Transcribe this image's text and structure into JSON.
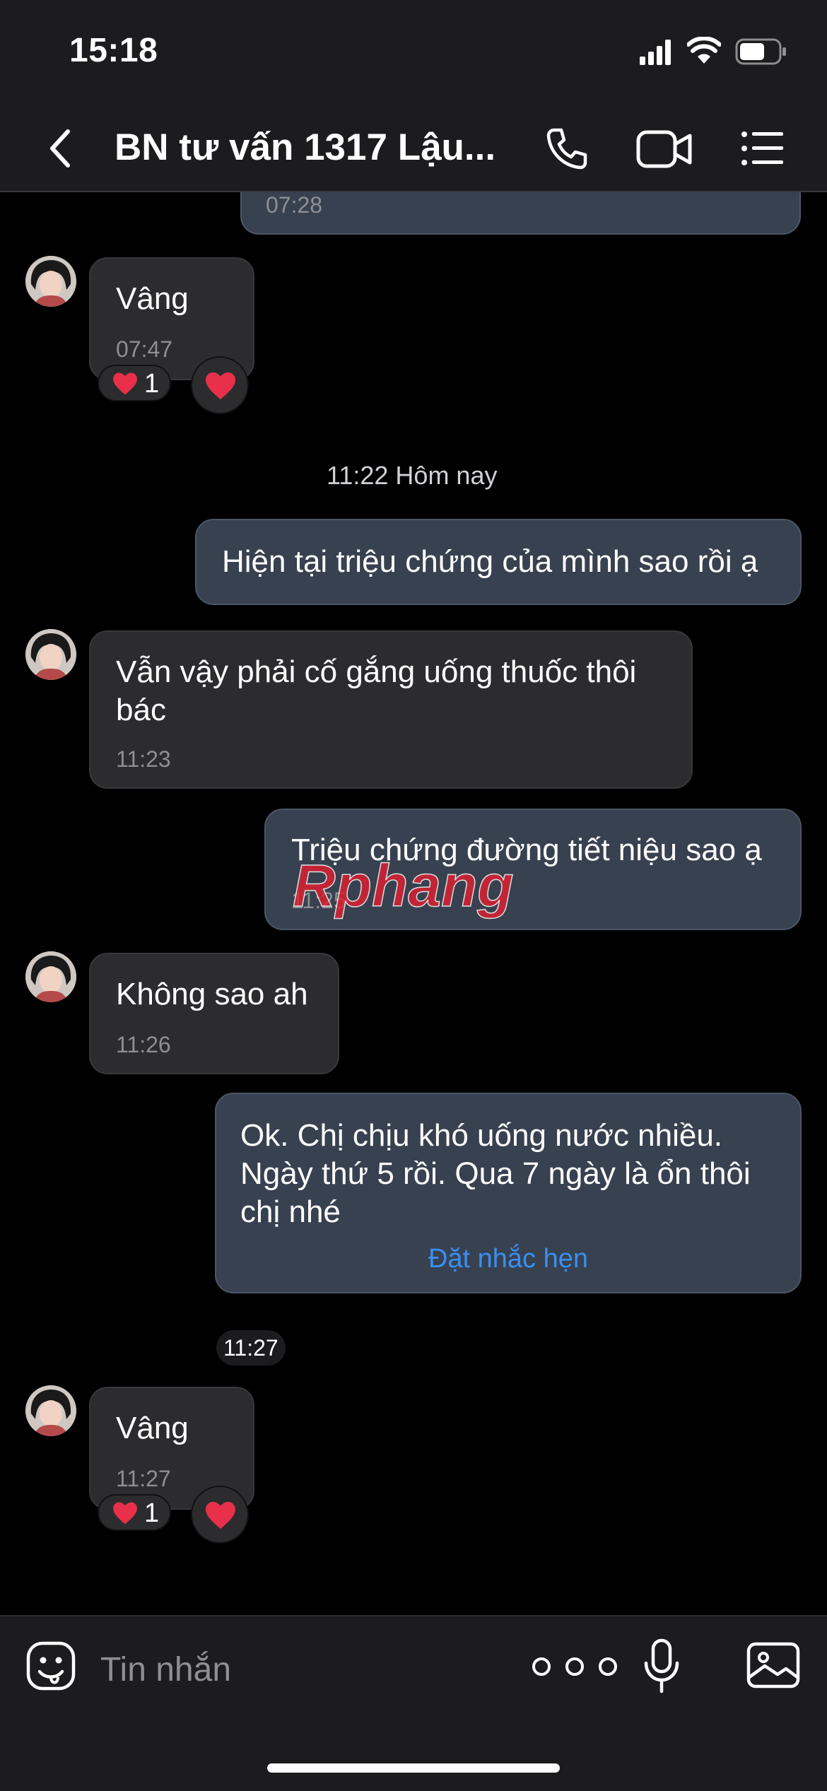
{
  "status_bar": {
    "time": "15:18"
  },
  "header": {
    "title": "BN tư vấn 1317 Lậu..."
  },
  "messages": {
    "prev_out_time": "07:28",
    "m1": {
      "text": "Vâng",
      "time": "07:47",
      "reaction_count": "1"
    },
    "date_separator": "11:22 Hôm nay",
    "m2": {
      "text": "Hiện tại triệu chứng của mình sao rồi ạ"
    },
    "m3": {
      "line1": "Vẫn vậy phải cố gắng uống thuốc thôi",
      "line2": "bác",
      "time": "11:23"
    },
    "m4": {
      "text": "Triệu chứng đường tiết niệu sao ạ",
      "time": "11:25"
    },
    "m5": {
      "text": "Không sao ah",
      "time": "11:26"
    },
    "m6": {
      "line1": "Ok. Chị chịu khó uống nước nhiều.",
      "line2": "Ngày thứ 5 rồi. Qua 7 ngày là ổn thôi",
      "line3": "chị nhé",
      "action": "Đặt nhắc hẹn",
      "time": "11:27"
    },
    "m7": {
      "text": "Vâng",
      "time": "11:27",
      "reaction_count": "1"
    }
  },
  "watermark": {
    "text": "Rphang"
  },
  "composer": {
    "placeholder": "Tin nhắn"
  },
  "colors": {
    "accent": "#3a8ff0",
    "outgoing_bubble": "#374150",
    "incoming_bubble": "#2c2c2e",
    "heart": "#e8304a"
  }
}
